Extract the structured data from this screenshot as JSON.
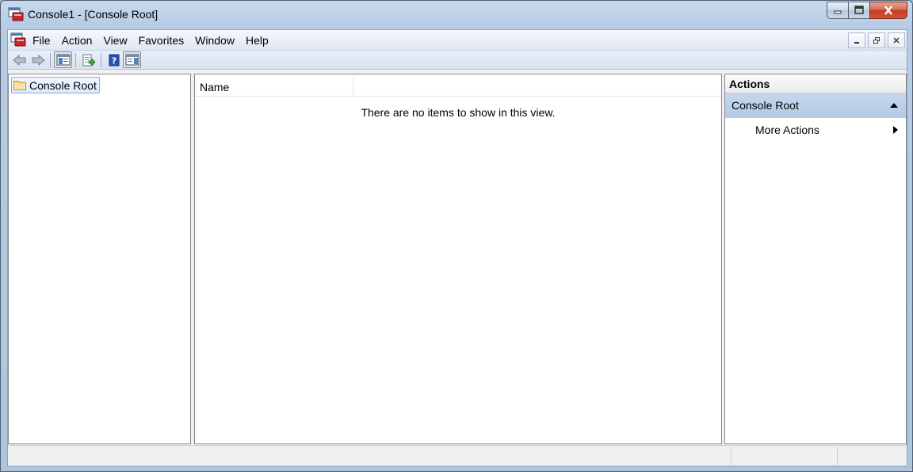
{
  "window": {
    "title": "Console1 - [Console Root]",
    "icon": "mmc-console-icon"
  },
  "caption": {
    "minimize_icon": "minimize-icon",
    "maximize_icon": "maximize-icon",
    "close_icon": "close-icon"
  },
  "menubar": {
    "items": [
      "File",
      "Action",
      "View",
      "Favorites",
      "Window",
      "Help"
    ]
  },
  "toolbar": {
    "buttons": [
      "back-arrow-icon",
      "forward-arrow-icon",
      "show-hide-tree-icon",
      "export-list-icon",
      "help-icon",
      "show-hide-action-pane-icon"
    ]
  },
  "tree": {
    "root_label": "Console Root"
  },
  "list": {
    "columns": [
      "Name"
    ],
    "empty_message": "There are no items to show in this view."
  },
  "actions": {
    "header": "Actions",
    "group_label": "Console Root",
    "items": [
      "More Actions"
    ]
  },
  "colors": {
    "selection_bg": "#dceafc",
    "actions_group_bg": "#b4cae4",
    "close_button": "#c23d22"
  }
}
